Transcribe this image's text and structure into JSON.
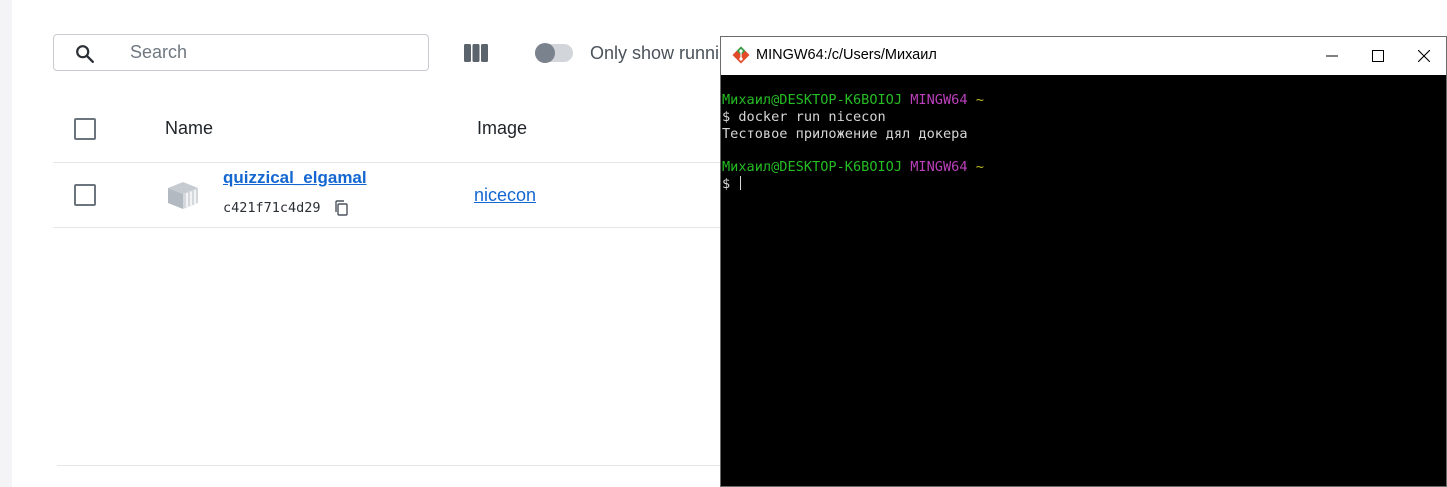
{
  "docker": {
    "search": {
      "placeholder": "Search",
      "value": ""
    },
    "columns_icon": "columns-icon",
    "toggle": {
      "label": "Only show runni",
      "checked": false
    },
    "table": {
      "headers": {
        "name": "Name",
        "image": "Image"
      },
      "rows": [
        {
          "name": "quizzical_elgamal",
          "id": "c421f71c4d29",
          "image": "nicecon",
          "icon": "container-icon"
        }
      ]
    },
    "accent": "#1467d1"
  },
  "terminal": {
    "title": "MINGW64:/c/Users/Михаил",
    "lines": [
      {
        "user": "Михаил@DESKTOP-K6BOIOJ",
        "env": "MINGW64",
        "path": "~"
      },
      {
        "prompt": "$",
        "cmd": "docker run nicecon"
      },
      {
        "output": "Тестовое приложение дял докера"
      },
      {
        "user": "Михаил@DESKTOP-K6BOIOJ",
        "env": "MINGW64",
        "path": "~"
      },
      {
        "prompt": "$",
        "cmd": ""
      }
    ],
    "colors": {
      "user": "#25bc24",
      "env": "#bc3fbc",
      "path": "#bcbc24",
      "text": "#d6d6d6",
      "background": "#000000"
    }
  }
}
